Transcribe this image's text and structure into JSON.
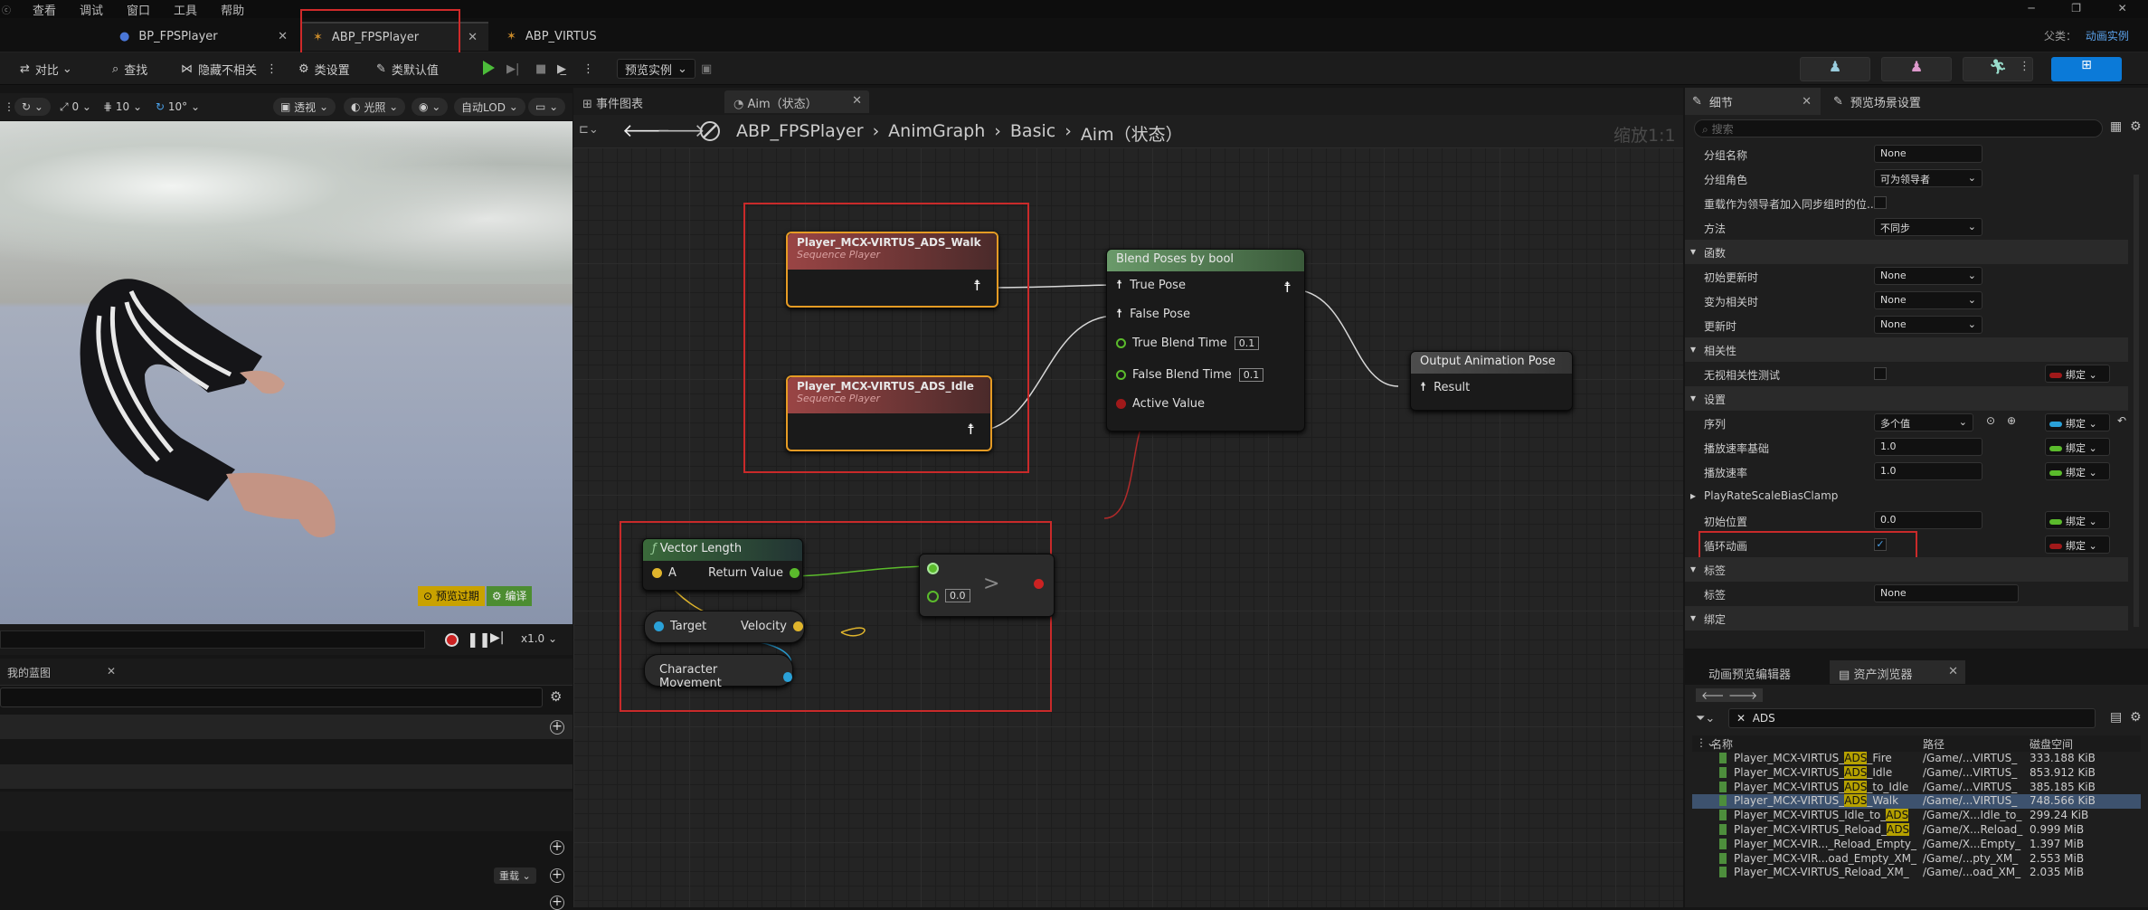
{
  "menu": [
    "查看",
    "调试",
    "窗口",
    "工具",
    "帮助"
  ],
  "doc_tabs": [
    {
      "label": "BP_FPSPlayer"
    },
    {
      "label": "ABP_FPSPlayer"
    },
    {
      "label": "ABP_VIRTUS"
    }
  ],
  "parent": {
    "label": "父类：",
    "value": "动画实例"
  },
  "toolbar": {
    "compare": "对比",
    "find": "查找",
    "hide": "隐藏不相关",
    "class_settings": "类设置",
    "class_defaults": "类默认值",
    "preview_instance": "预览实例"
  },
  "viewport_toolbar": {
    "val1": "0",
    "val2": "10",
    "val3": "10°",
    "perspective": "透视",
    "lighting": "光照",
    "lod": "自动LOD"
  },
  "viewport": {
    "badge1": "预览过期",
    "badge2": "编译",
    "speed": "x1.0"
  },
  "my_blueprint": {
    "title": "我的蓝图",
    "sort": "重载"
  },
  "graph_tabs": [
    {
      "label": "事件图表"
    },
    {
      "label": "Aim（状态）"
    }
  ],
  "breadcrumb": [
    "ABP_FPSPlayer",
    "AnimGraph",
    "Basic",
    "Aim（状态）"
  ],
  "zoom": "缩放1:1",
  "nodes": {
    "walk": {
      "title": "Player_MCX-VIRTUS_ADS_Walk",
      "sub": "Sequence Player"
    },
    "idle": {
      "title": "Player_MCX-VIRTUS_ADS_Idle",
      "sub": "Sequence Player"
    },
    "blend": {
      "title": "Blend Poses by bool",
      "true_pose": "True Pose",
      "false_pose": "False Pose",
      "true_time": "True Blend Time",
      "true_time_val": "0.1",
      "false_time": "False Blend Time",
      "false_time_val": "0.1",
      "active": "Active Value"
    },
    "output": {
      "title": "Output Animation Pose",
      "result": "Result"
    },
    "vlen": {
      "title": "Vector Length",
      "a": "A",
      "ret": "Return Value"
    },
    "get_vel": {
      "target": "Target",
      "velocity": "Velocity"
    },
    "char_move": {
      "label": "Character Movement"
    },
    "greater": {
      "op": ">",
      "val": "0.0"
    }
  },
  "details": {
    "tab1": "细节",
    "tab2": "预览场景设置",
    "search_placeholder": "搜索",
    "rows": [
      {
        "label": "分组名称",
        "value": "None"
      },
      {
        "label": "分组角色",
        "value": "可为领导者"
      },
      {
        "label": "重载作为领导者加入同步组时的位...",
        "value": ""
      },
      {
        "label": "方法",
        "value": "不同步"
      }
    ],
    "sections": {
      "func": "函数",
      "relevance": "相关性",
      "settings": "设置",
      "tags": "标签",
      "binding": "绑定"
    },
    "func_rows": [
      {
        "label": "初始更新时",
        "value": "None"
      },
      {
        "label": "变为相关时",
        "value": "None"
      },
      {
        "label": "更新时",
        "value": "None"
      }
    ],
    "relevance_row": {
      "label": "无视相关性测试"
    },
    "settings_rows": [
      {
        "label": "序列",
        "value": "多个值"
      },
      {
        "label": "播放速率基础",
        "value": "1.0"
      },
      {
        "label": "播放速率",
        "value": "1.0"
      },
      {
        "label": "PlayRateScaleBiasClamp",
        "value": ""
      },
      {
        "label": "初始位置",
        "value": "0.0"
      },
      {
        "label": "循环动画",
        "value": ""
      }
    ],
    "tag_row": {
      "label": "标签",
      "value": "None"
    },
    "bind_label": "绑定"
  },
  "asset": {
    "tab1": "动画预览编辑器",
    "tab2": "资产浏览器",
    "filter": "ADS",
    "cols": {
      "name": "名称",
      "path": "路径",
      "size": "磁盘空间"
    },
    "rows": [
      {
        "pre": "Player_MCX-VIRTUS_",
        "hl": "ADS",
        "post": "_Fire",
        "path": "/Game/...VIRTUS_",
        "size": "333.188 KiB"
      },
      {
        "pre": "Player_MCX-VIRTUS_",
        "hl": "ADS",
        "post": "_Idle",
        "path": "/Game/...VIRTUS_",
        "size": "853.912 KiB"
      },
      {
        "pre": "Player_MCX-VIRTUS_",
        "hl": "ADS",
        "post": "_to_Idle",
        "path": "/Game/...VIRTUS_",
        "size": "385.185 KiB"
      },
      {
        "pre": "Player_MCX-VIRTUS_",
        "hl": "ADS",
        "post": "_Walk",
        "path": "/Game/...VIRTUS_",
        "size": "748.566 KiB"
      },
      {
        "pre": "Player_MCX-VIRTUS_Idle_to_",
        "hl": "ADS",
        "post": "",
        "path": "/Game/X...Idle_to_",
        "size": "299.24 KiB"
      },
      {
        "pre": "Player_MCX-VIRTUS_Reload_",
        "hl": "ADS",
        "post": "",
        "path": "/Game/X...Reload_",
        "size": "0.999 MiB"
      },
      {
        "pre": "Player_MCX-VIR..._Reload_Empty_",
        "hl": "",
        "post": "",
        "path": "/Game/X...Empty_",
        "size": "1.397 MiB"
      },
      {
        "pre": "Player_MCX-VIR...oad_Empty_XM_",
        "hl": "",
        "post": "",
        "path": "/Game/...pty_XM_",
        "size": "2.553 MiB"
      },
      {
        "pre": "Player_MCX-VIRTUS_Reload_XM_",
        "hl": "",
        "post": "",
        "path": "/Game/...oad_XM_",
        "size": "2.035 MiB"
      }
    ]
  },
  "colors": {
    "exec_green": "#6e9c5a",
    "seq_header": "#8a3f3f",
    "blend_header": "#5e8f5e",
    "red_box": "#c92a2a",
    "selected_row": "#3d526e",
    "accent_blue": "#0b7ad8"
  }
}
